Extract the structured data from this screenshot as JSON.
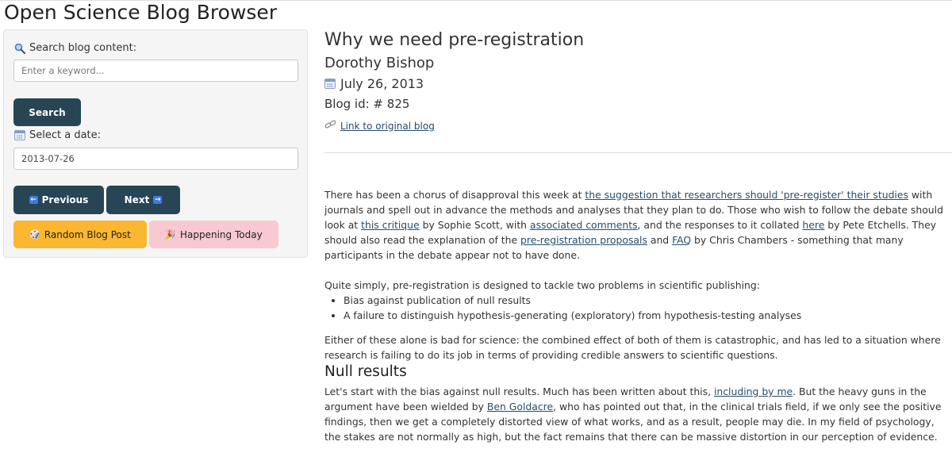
{
  "app": {
    "title": "Open Science Blog Browser"
  },
  "sidebar": {
    "search_label": "Search blog content:",
    "search_placeholder": "Enter a keyword...",
    "search_value": "",
    "search_button": "Search",
    "date_label": "Select a date:",
    "date_value": "2013-07-26",
    "prev_button": "Previous",
    "next_button": "Next",
    "random_button": "Random Blog Post",
    "today_button": "Happening Today"
  },
  "post": {
    "title": "Why we need pre-registration",
    "author": "Dorothy Bishop",
    "date": "July 26, 2013",
    "blog_id": "Blog id: # 825",
    "original_link": "Link to original blog",
    "p1": {
      "t1": "There has been a chorus of disapproval this week at ",
      "l1": "the suggestion that researchers should 'pre-register' their studies",
      "t2": " with journals and spell out in advance the methods and analyses that they plan to do. Those who wish to follow the debate should look at ",
      "l2": "this critique",
      "t3": " by Sophie Scott, with ",
      "l3": "associated comments",
      "t4": ", and the responses to it collated ",
      "l4": "here",
      "t5": " by Pete Etchells. They should also read the explanation of the ",
      "l5": "pre-registration proposals",
      "t6": " and ",
      "l6": "FAQ",
      "t7": "  by Chris Chambers - something that many participants in the debate appear not to have done."
    },
    "p2": "Quite simply, pre-registration is designed to tackle two problems in scientific publishing:",
    "bullets": [
      "Bias against publication of null results",
      "A failure to distinguish hypothesis-generating (exploratory) from hypothesis-testing analyses"
    ],
    "p3": "Either of these alone is bad for science: the combined effect of both of them is catastrophic, and has led to a situation where research is failing to do its job in terms of providing credible answers to scientific questions.",
    "h_null": "Null results",
    "p4": {
      "t1": "Let's start with the bias against null results. Much has been written about this, ",
      "l1": "including by me",
      "t2": ". But the heavy guns in the argument have been wielded by ",
      "l2": "Ben Goldacre",
      "t3": ", who has pointed out that, in the clinical trials field, if we only see the positive findings, then we get a completely distorted view of what works, and as a result, people may die. In my field of psychology, the stakes are not normally as high, but the fact remains that there can be massive distortion in our perception of evidence."
    }
  },
  "icons": {
    "search": "magnifier-icon",
    "calendar": "calendar-icon",
    "link": "link-icon",
    "prev": "left-arrow-icon",
    "next": "right-arrow-icon",
    "random": "dice-icon",
    "today": "party-popper-icon"
  },
  "colors": {
    "dark_button": "#274555",
    "random_button": "#fbb731",
    "today_button": "#f8c9d0",
    "link": "#274d6e"
  }
}
